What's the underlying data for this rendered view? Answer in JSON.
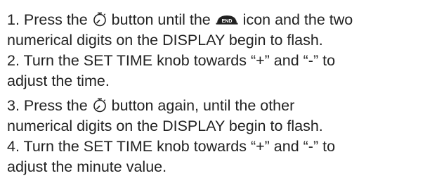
{
  "steps": [
    {
      "line1_a": "1. Press the ",
      "line1_b": " button until the ",
      "line1_c": " icon and the two",
      "line2": "numerical digits on the DISPLAY begin to flash."
    },
    {
      "line1": "2. Turn the SET TIME knob towards “+” and “-” to",
      "line2": "adjust the time."
    },
    {
      "line1_a": "3. Press the ",
      "line1_b": " button again, until the other",
      "line2": "numerical digits on the DISPLAY begin to flash."
    },
    {
      "line1": "4. Turn the SET TIME knob towards “+” and “-” to",
      "line2": "adjust the minute value."
    }
  ],
  "icons": {
    "timer": "timer-icon",
    "end_badge": "end-icon",
    "end_badge_text": "END"
  }
}
